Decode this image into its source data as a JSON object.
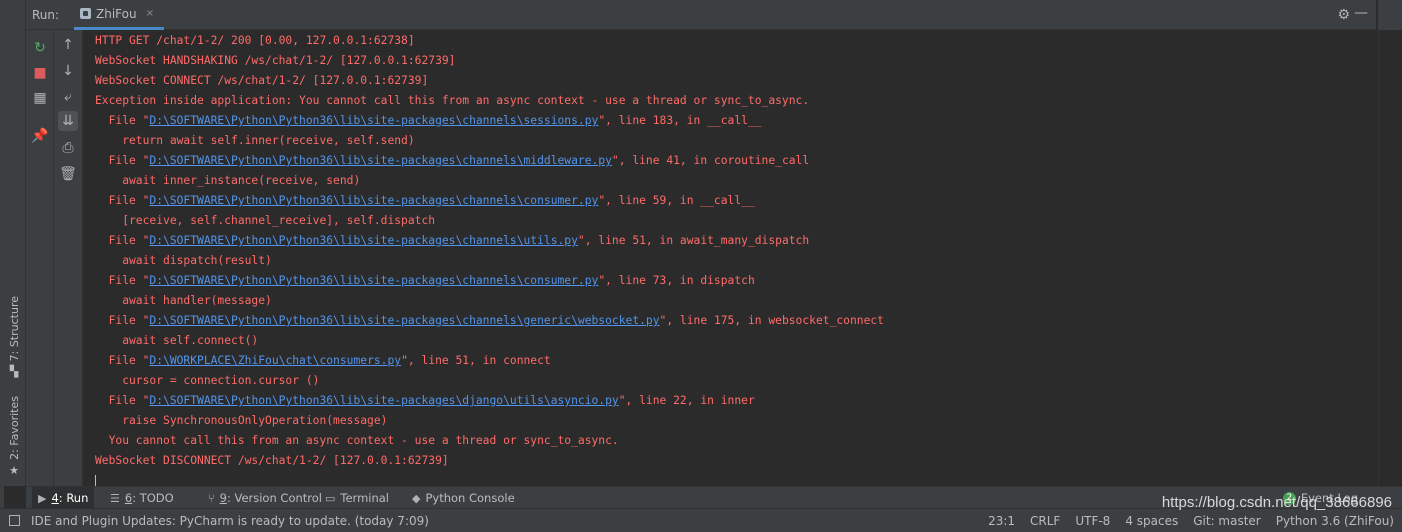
{
  "run_header": {
    "title": "Run:",
    "tab_label": "ZhiFou",
    "close_glyph": "×",
    "gear_glyph": "⚙",
    "minimize_glyph": "—"
  },
  "left_strip": {
    "structure_label": "7: Structure",
    "favorites_label": "2: Favorites"
  },
  "toolbar_1": [
    {
      "name": "rerun-icon",
      "glyph": "↻",
      "color": "#59a869"
    },
    {
      "name": "stop-icon",
      "glyph": "■",
      "color": "#db5c5c"
    },
    {
      "name": "layout-icon",
      "glyph": "▦",
      "color": "#afb1b3"
    },
    {
      "name": "pin-icon",
      "glyph": "📌",
      "color": "#afb1b3"
    }
  ],
  "toolbar_2": [
    {
      "name": "up-arrow-icon",
      "glyph": "↑"
    },
    {
      "name": "down-arrow-icon",
      "glyph": "↓"
    },
    {
      "name": "soft-wrap-icon",
      "glyph": "⤶"
    },
    {
      "name": "scroll-to-end-icon",
      "glyph": "⇊"
    },
    {
      "name": "print-icon",
      "glyph": "⎙"
    },
    {
      "name": "trash-icon",
      "glyph": "🗑"
    }
  ],
  "console": {
    "lines": [
      {
        "parts": [
          {
            "t": "HTTP GET /chat/1-2/ 200 [0.00, 127.0.0.1:62738]"
          }
        ]
      },
      {
        "parts": [
          {
            "t": "WebSocket HANDSHAKING /ws/chat/1-2/ [127.0.0.1:62739]"
          }
        ]
      },
      {
        "parts": [
          {
            "t": "WebSocket CONNECT /ws/chat/1-2/ [127.0.0.1:62739]"
          }
        ]
      },
      {
        "parts": [
          {
            "t": "Exception inside application: You cannot call this from an async context - use a thread or sync_to_async."
          }
        ]
      },
      {
        "parts": [
          {
            "t": "  File \""
          },
          {
            "t": "D:\\SOFTWARE\\Python\\Python36\\lib\\site-packages\\channels\\sessions.py",
            "link": true
          },
          {
            "t": "\", line 183, in __call__"
          }
        ]
      },
      {
        "parts": [
          {
            "t": "    return await self.inner(receive, self.send)"
          }
        ]
      },
      {
        "parts": [
          {
            "t": "  File \""
          },
          {
            "t": "D:\\SOFTWARE\\Python\\Python36\\lib\\site-packages\\channels\\middleware.py",
            "link": true
          },
          {
            "t": "\", line 41, in coroutine_call"
          }
        ]
      },
      {
        "parts": [
          {
            "t": "    await inner_instance(receive, send)"
          }
        ]
      },
      {
        "parts": [
          {
            "t": "  File \""
          },
          {
            "t": "D:\\SOFTWARE\\Python\\Python36\\lib\\site-packages\\channels\\consumer.py",
            "link": true
          },
          {
            "t": "\", line 59, in __call__"
          }
        ]
      },
      {
        "parts": [
          {
            "t": "    [receive, self.channel_receive], self.dispatch"
          }
        ]
      },
      {
        "parts": [
          {
            "t": "  File \""
          },
          {
            "t": "D:\\SOFTWARE\\Python\\Python36\\lib\\site-packages\\channels\\utils.py",
            "link": true
          },
          {
            "t": "\", line 51, in await_many_dispatch"
          }
        ]
      },
      {
        "parts": [
          {
            "t": "    await dispatch(result)"
          }
        ]
      },
      {
        "parts": [
          {
            "t": "  File \""
          },
          {
            "t": "D:\\SOFTWARE\\Python\\Python36\\lib\\site-packages\\channels\\consumer.py",
            "link": true
          },
          {
            "t": "\", line 73, in dispatch"
          }
        ]
      },
      {
        "parts": [
          {
            "t": "    await handler(message)"
          }
        ]
      },
      {
        "parts": [
          {
            "t": "  File \""
          },
          {
            "t": "D:\\SOFTWARE\\Python\\Python36\\lib\\site-packages\\channels\\generic\\websocket.py",
            "link": true
          },
          {
            "t": "\", line 175, in websocket_connect"
          }
        ]
      },
      {
        "parts": [
          {
            "t": "    await self.connect()"
          }
        ]
      },
      {
        "parts": [
          {
            "t": "  File \""
          },
          {
            "t": "D:\\WORKPLACE\\ZhiFou\\chat\\consumers.py",
            "link": true
          },
          {
            "t": "\", line 51, in connect"
          }
        ]
      },
      {
        "parts": [
          {
            "t": "    cursor = connection.cursor ()"
          }
        ]
      },
      {
        "parts": [
          {
            "t": "  File \""
          },
          {
            "t": "D:\\SOFTWARE\\Python\\Python36\\lib\\site-packages\\django\\utils\\asyncio.py",
            "link": true
          },
          {
            "t": "\", line 22, in inner"
          }
        ]
      },
      {
        "parts": [
          {
            "t": "    raise SynchronousOnlyOperation(message)"
          }
        ]
      },
      {
        "parts": [
          {
            "t": "  You cannot call this from an async context - use a thread or sync_to_async."
          }
        ]
      },
      {
        "parts": [
          {
            "t": "WebSocket DISCONNECT /ws/chat/1-2/ [127.0.0.1:62739]"
          }
        ]
      }
    ],
    "error_color": "#ff6b68",
    "link_color": "#5394ec"
  },
  "tool_tabs": [
    {
      "name": "tab-run",
      "icon": "▶",
      "num": "4",
      "label": ": Run",
      "active": true
    },
    {
      "name": "tab-todo",
      "icon": "☰",
      "num": "6",
      "label": ": TODO",
      "active": false
    },
    {
      "name": "tab-version-control",
      "icon": "⑂",
      "num": "9",
      "label": ": Version Control",
      "active": false
    },
    {
      "name": "tab-terminal",
      "icon": "▭",
      "num": "",
      "label": "Terminal",
      "active": false
    },
    {
      "name": "tab-python-console",
      "icon": "◆",
      "num": "",
      "label": "Python Console",
      "active": false
    }
  ],
  "event_log": {
    "badge": "2",
    "label": "Event Log"
  },
  "status_bar": {
    "message": "IDE and Plugin Updates: PyCharm is ready to update. (today 7:09)",
    "position": "23:1",
    "line_sep": "CRLF",
    "encoding": "UTF-8",
    "indent": "4 spaces",
    "vcs": "Git: master",
    "interpreter": "Python 3.6 (ZhiFou)"
  },
  "watermark": "https://blog.csdn.net/qq_38666896"
}
